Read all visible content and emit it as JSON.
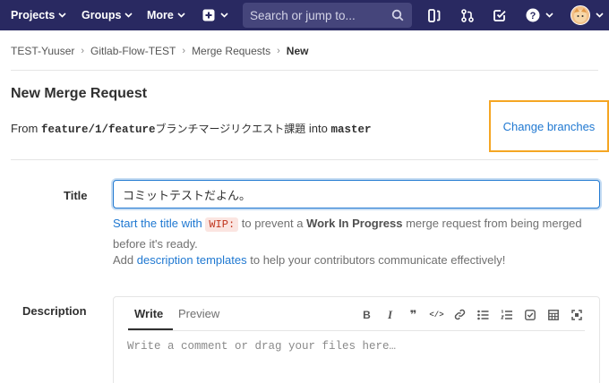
{
  "navbar": {
    "projects": "Projects",
    "groups": "Groups",
    "more": "More",
    "search_placeholder": "Search or jump to..."
  },
  "icons": {
    "new": "plus-square-icon",
    "issues": "todo-icon",
    "merge_requests": "merge-request-icon",
    "todos": "check-square-icon",
    "help": "question-icon",
    "user": "avatar"
  },
  "breadcrumb": {
    "items": [
      "TEST-Yuuser",
      "Gitlab-Flow-TEST",
      "Merge Requests"
    ],
    "current": "New"
  },
  "page": {
    "title": "New Merge Request",
    "from_label": "From",
    "source_branch": "feature/1/feature",
    "source_branch_suffix": "ブランチマージリクエスト課題",
    "into_label": "into",
    "target_branch": "master",
    "change_branches": "Change branches"
  },
  "form": {
    "title_label": "Title",
    "title_value": "コミットテストだよん。",
    "hint": {
      "part1": "Start the title with",
      "code": "WIP:",
      "part2": "to prevent a",
      "bold": "Work In Progress",
      "part3": "merge request from being merged before it's ready."
    },
    "templates": {
      "prefix": "Add",
      "link": "description templates",
      "suffix": "to help your contributors communicate effectively!"
    },
    "description_label": "Description",
    "tabs": {
      "write": "Write",
      "preview": "Preview"
    },
    "toolbar": {
      "bold": "B",
      "italic": "I",
      "quote": "❞",
      "code": "</>"
    },
    "description_placeholder": "Write a comment or drag your files here…"
  },
  "colors": {
    "navbar": "#292961",
    "link": "#1f78d1",
    "highlight_border": "#f5a623"
  }
}
